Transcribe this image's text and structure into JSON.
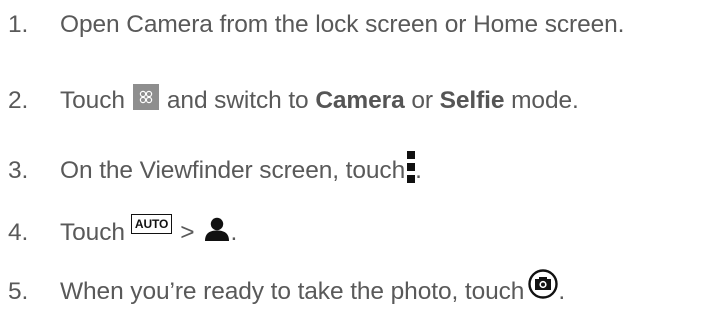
{
  "steps": [
    {
      "number": "1.",
      "text": "Open Camera from the lock screen or Home screen."
    },
    {
      "number": "2.",
      "before": "Touch",
      "icon": "camera-modes-icon",
      "middle": "and switch to",
      "bold1": "Camera",
      "or": "or",
      "bold2": "Selfie",
      "after": "mode."
    },
    {
      "number": "3.",
      "before": "On the Viewfinder screen, touch",
      "icon": "more-options-icon",
      "after": "."
    },
    {
      "number": "4.",
      "before": "Touch",
      "icon_label": "AUTO",
      "separator": ">",
      "icon2": "person-icon",
      "after": "."
    },
    {
      "number": "5.",
      "before": "When you’re ready to take the photo, touch",
      "icon": "camera-shutter-icon",
      "after": "."
    }
  ]
}
